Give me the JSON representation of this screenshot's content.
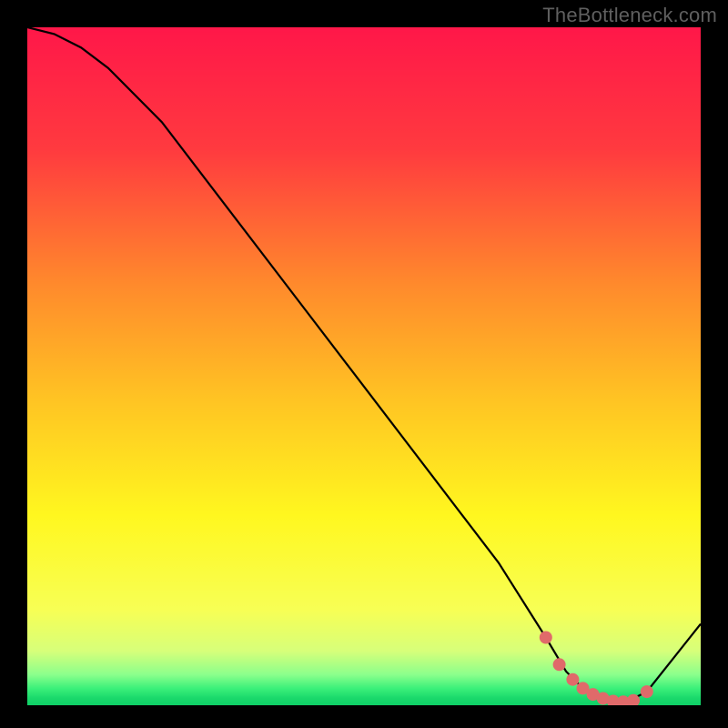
{
  "watermark": "TheBottleneck.com",
  "chart_data": {
    "type": "line",
    "title": "",
    "xlabel": "",
    "ylabel": "",
    "xlim": [
      0,
      100
    ],
    "ylim": [
      0,
      100
    ],
    "series": [
      {
        "name": "curve",
        "x": [
          0,
          4,
          8,
          12,
          20,
          30,
          40,
          50,
          60,
          70,
          77,
          80,
          83,
          86,
          89,
          92,
          100
        ],
        "y": [
          100,
          99,
          97,
          94,
          86,
          73,
          60,
          47,
          34,
          21,
          10,
          5,
          2,
          0.5,
          0.5,
          2,
          12
        ]
      }
    ],
    "markers": {
      "name": "highlight-dots",
      "x": [
        77,
        79,
        81,
        82.5,
        84,
        85.5,
        87,
        88.5,
        90,
        92
      ],
      "y": [
        10,
        6,
        3.8,
        2.5,
        1.6,
        1.0,
        0.6,
        0.5,
        0.7,
        2.0
      ]
    },
    "gradient_stops": [
      {
        "offset": 0.0,
        "color": "#ff1749"
      },
      {
        "offset": 0.18,
        "color": "#ff3a3f"
      },
      {
        "offset": 0.38,
        "color": "#ff8a2c"
      },
      {
        "offset": 0.55,
        "color": "#ffc423"
      },
      {
        "offset": 0.72,
        "color": "#fff71f"
      },
      {
        "offset": 0.86,
        "color": "#f7ff55"
      },
      {
        "offset": 0.92,
        "color": "#d7ff7a"
      },
      {
        "offset": 0.955,
        "color": "#8bff8c"
      },
      {
        "offset": 0.975,
        "color": "#3bf07a"
      },
      {
        "offset": 0.99,
        "color": "#19d86b"
      },
      {
        "offset": 1.0,
        "color": "#0fd067"
      }
    ],
    "marker_color": "#e06a6a",
    "curve_color": "#000000"
  }
}
